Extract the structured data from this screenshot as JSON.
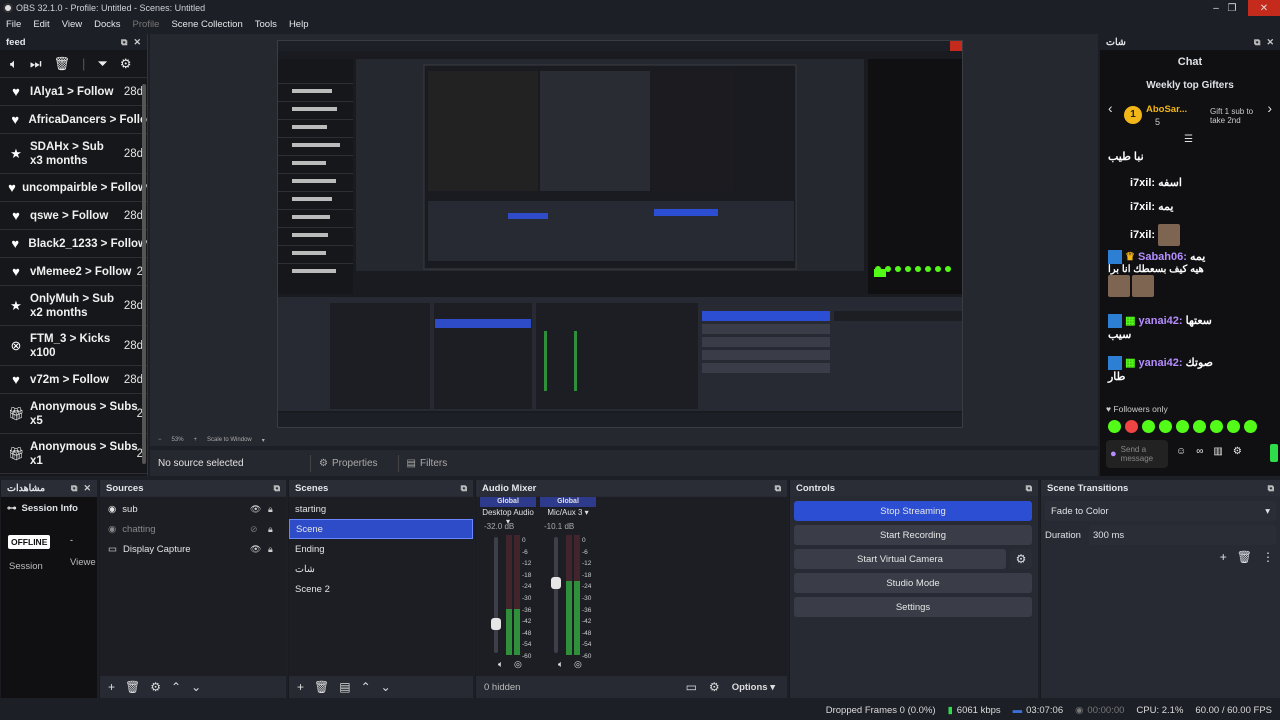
{
  "window": {
    "title": "OBS 32.1.0 - Profile: Untitled - Scenes: Untitled"
  },
  "menu": [
    "File",
    "Edit",
    "View",
    "Docks",
    "Profile",
    "Scene Collection",
    "Tools",
    "Help"
  ],
  "feed": {
    "title": "feed",
    "items": [
      {
        "icon": "heart-icon",
        "text": "IAlya1 > Follow",
        "age": "28d"
      },
      {
        "icon": "heart-icon",
        "text": "AfricaDancers > Follo",
        "age": ""
      },
      {
        "icon": "star-icon",
        "text": "SDAHx > Sub\nx3 months",
        "age": "28d"
      },
      {
        "icon": "heart-icon",
        "text": "uncompairble > Follow",
        "age": ""
      },
      {
        "icon": "heart-icon",
        "text": "qswe > Follow",
        "age": "28d"
      },
      {
        "icon": "heart-icon",
        "text": "Black2_1233 > Follow",
        "age": ""
      },
      {
        "icon": "heart-icon",
        "text": "vMemee2 > Follow",
        "age": "2"
      },
      {
        "icon": "star-icon",
        "text": "OnlyMuh > Sub\nx2 months",
        "age": "28d"
      },
      {
        "icon": "kick-icon",
        "text": "FTM_3 > Kicks\nx100",
        "age": "28d"
      },
      {
        "icon": "heart-icon",
        "text": "v72m > Follow",
        "age": "28d"
      },
      {
        "icon": "gift-icon",
        "text": "Anonymous > Subs\nx5",
        "age": "2"
      },
      {
        "icon": "gift-icon",
        "text": "Anonymous > Subs\nx1",
        "age": "2"
      }
    ]
  },
  "preview": {
    "zoom": "53%",
    "scale": "Scale to Window",
    "no_source": "No source selected",
    "properties": "Properties",
    "filters": "Filters"
  },
  "chat": {
    "dock_title": "شات",
    "title": "Chat",
    "gifters_title": "Weekly top Gifters",
    "gifter_name": "AboSar...",
    "gifter_count": "5",
    "gift_hint": "Gift 1 sub to take 2nd",
    "msg1": "نبا طيب",
    "msg2_user": "i7xil:",
    "msg2_text": "اسفه",
    "msg3_user": "i7xil:",
    "msg3_text": "يمه",
    "msg4_user": "i7xil:",
    "msg5_user": "Sabah06:",
    "msg5_text": "يمه",
    "msg5_line2": "هيه كيف بسعطك انا برا",
    "msg6_user": "yanai42:",
    "msg6_text": "سعتها",
    "msg6_line2": "سيب",
    "msg7_user": "yanai42:",
    "msg7_text": "صوتك",
    "msg7_line2": "طار",
    "followers_only": "Followers only",
    "send_placeholder": "Send a message"
  },
  "viewers_dock": {
    "title": "مشاهدات",
    "session_info": "Session Info",
    "offline": "OFFLINE",
    "dash": "-",
    "session": "Session",
    "viewers": "Viewe"
  },
  "sources": {
    "title": "Sources",
    "items": [
      "sub",
      "chatting",
      "Display Capture"
    ]
  },
  "scenes": {
    "title": "Scenes",
    "items": [
      "starting",
      "Scene",
      "Ending",
      "شات",
      "Scene 2"
    ],
    "selected": 1
  },
  "mixer": {
    "title": "Audio Mixer",
    "channels": [
      {
        "group": "Global",
        "name": "Desktop Audio",
        "db": "-32.0 dB",
        "level": 0.38,
        "fader": 0.22
      },
      {
        "group": "Global",
        "name": "Mic/Aux 3",
        "db": "-10.1 dB",
        "level": 0.62,
        "fader": 0.62
      }
    ],
    "ticks": [
      "0",
      "-6",
      "-12",
      "-18",
      "-24",
      "-30",
      "-36",
      "-42",
      "-48",
      "-54",
      "-60"
    ],
    "hidden": "0 hidden",
    "options": "Options"
  },
  "controls": {
    "title": "Controls",
    "buttons": [
      "Stop Streaming",
      "Start Recording",
      "Start Virtual Camera",
      "Studio Mode",
      "Settings"
    ]
  },
  "transitions": {
    "title": "Scene Transitions",
    "value": "Fade to Color",
    "duration_label": "Duration",
    "duration_value": "300 ms"
  },
  "status": {
    "dropped": "Dropped Frames 0 (0.0%)",
    "bitrate": "6061 kbps",
    "live_time": "03:07:06",
    "rec_time": "00:00:00",
    "cpu": "CPU: 2.1%",
    "fps": "60.00 / 60.00 FPS"
  },
  "colors": {
    "accent": "#2c4ed3",
    "live_green": "#2fdc4a",
    "kick_green": "#53fc18"
  }
}
